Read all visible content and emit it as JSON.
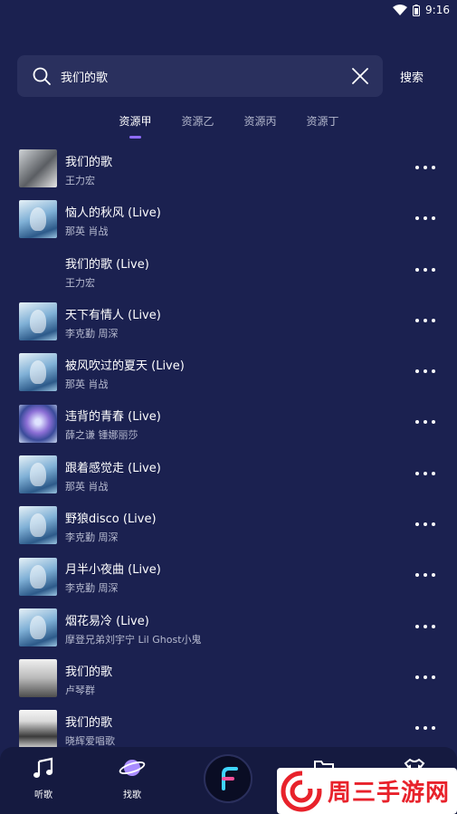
{
  "status_bar": {
    "time": "9:16"
  },
  "search": {
    "value": "我们的歌",
    "button_label": "搜索"
  },
  "tabs": [
    {
      "label": "资源甲",
      "active": true
    },
    {
      "label": "资源乙",
      "active": false
    },
    {
      "label": "资源丙",
      "active": false
    },
    {
      "label": "资源丁",
      "active": false
    }
  ],
  "songs": [
    {
      "title": "我们的歌",
      "artist": "王力宏",
      "cover": "c1"
    },
    {
      "title": "恼人的秋风 (Live)",
      "artist": "那英  肖战",
      "cover": "c2"
    },
    {
      "title": "我们的歌 (Live)",
      "artist": "王力宏",
      "cover": "none"
    },
    {
      "title": "天下有情人 (Live)",
      "artist": "李克勤  周深",
      "cover": "c2"
    },
    {
      "title": "被风吹过的夏天 (Live)",
      "artist": "那英  肖战",
      "cover": "c2"
    },
    {
      "title": "违背的青春 (Live)",
      "artist": "薛之谦  锺娜丽莎",
      "cover": "c3"
    },
    {
      "title": "跟着感觉走 (Live)",
      "artist": "那英  肖战",
      "cover": "c2"
    },
    {
      "title": "野狼disco (Live)",
      "artist": "李克勤  周深",
      "cover": "c2"
    },
    {
      "title": "月半小夜曲 (Live)",
      "artist": "李克勤  周深",
      "cover": "c2"
    },
    {
      "title": "烟花易冷 (Live)",
      "artist": "摩登兄弟刘宇宁  Lil Ghost小鬼",
      "cover": "c2"
    },
    {
      "title": "我们的歌",
      "artist": "卢琴群",
      "cover": "c4"
    },
    {
      "title": "我们的歌",
      "artist": "晓辉爱唱歌",
      "cover": "c5"
    }
  ],
  "bottom_nav": {
    "listen_label": "听歌",
    "find_label": "找歌"
  },
  "watermark": {
    "text": "周三手游网"
  },
  "colors": {
    "background": "#1b2150",
    "accent": "#8f6cff",
    "watermark_red": "#e8222b"
  }
}
